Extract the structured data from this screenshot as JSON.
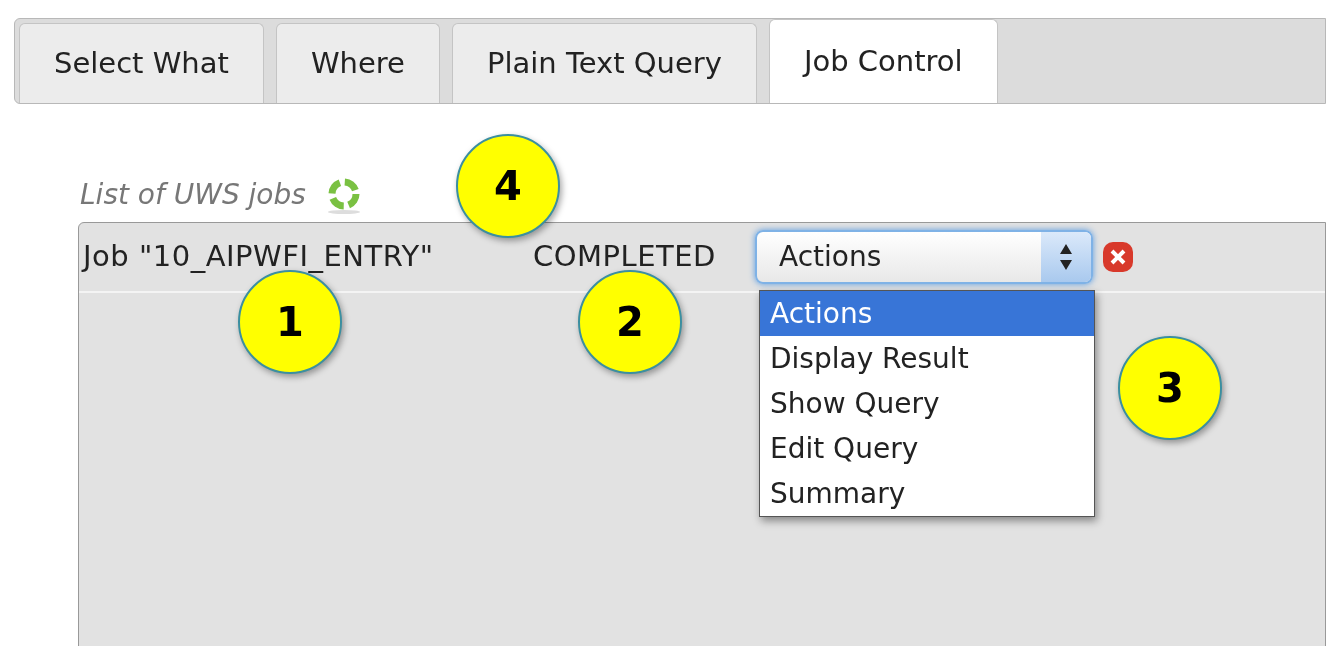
{
  "tabs": [
    {
      "label": "Select What",
      "selected": false
    },
    {
      "label": "Where",
      "selected": false
    },
    {
      "label": "Plain Text Query",
      "selected": false
    },
    {
      "label": "Job Control",
      "selected": true
    }
  ],
  "jobs_label": "List of UWS jobs",
  "job": {
    "name": "Job \"10_AIPWFI_ENTRY\"",
    "status": "COMPLETED",
    "select_value": "Actions",
    "options": [
      {
        "label": "Actions",
        "selected": true
      },
      {
        "label": "Display Result",
        "selected": false
      },
      {
        "label": "Show Query",
        "selected": false
      },
      {
        "label": "Edit Query",
        "selected": false
      },
      {
        "label": "Summary",
        "selected": false
      }
    ]
  },
  "callouts": [
    "1",
    "2",
    "3",
    "4"
  ]
}
